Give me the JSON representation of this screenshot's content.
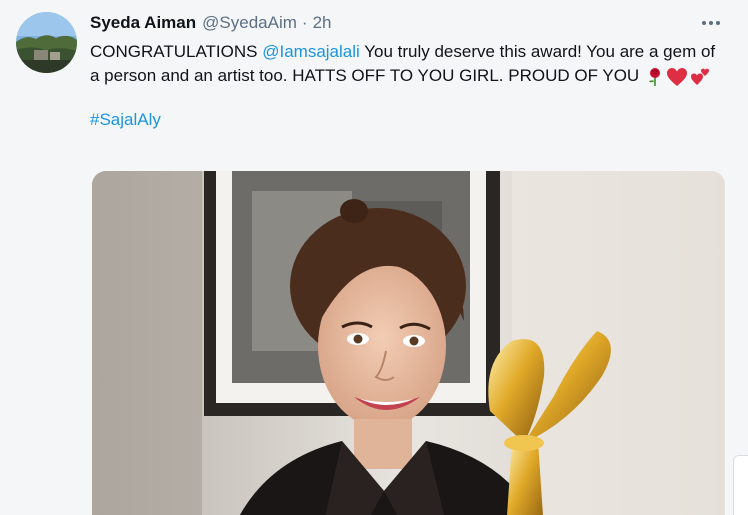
{
  "tweet": {
    "author_name": "Syeda Aiman",
    "author_handle": "@SyedaAim",
    "separator": "·",
    "time": "2h",
    "text_start": "CONGRATULATIONS ",
    "mention": "@Iamsajalali",
    "text_rest": " You truly deserve this award! You are a gem of a person and an artist too. HATTS OFF TO YOU GIRL. PROUD OF YOU",
    "emojis": [
      "rose-icon",
      "red-heart-icon",
      "two-hearts-icon"
    ],
    "hashtag": "#SajalAly"
  },
  "colors": {
    "link": "#1b95e0",
    "secondary_text": "#5b7083",
    "primary_text": "#0f1419",
    "background": "#f5f6f7"
  }
}
